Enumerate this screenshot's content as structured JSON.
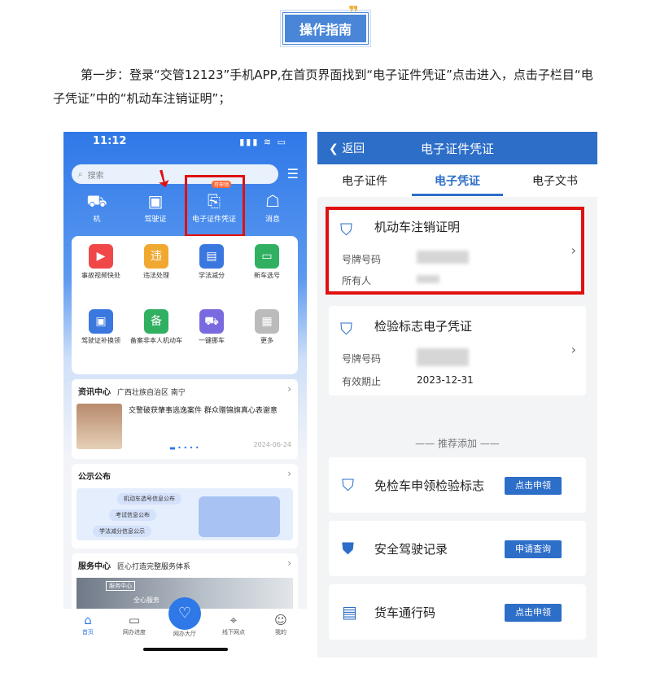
{
  "header": {
    "title": "操作指南",
    "quote_glyph": "❞"
  },
  "instruction": "第一步：登录“交管12123”手机APP,在首页界面找到“电子证件凭证”点击进入，点击子栏目“电子凭证”中的“机动车注销证明”；",
  "left_phone": {
    "time": "11:12",
    "signal": "▮▮▮ ≋ ▭",
    "search_placeholder": "搜索",
    "top_icons": [
      {
        "icon": "car-icon",
        "label": "机"
      },
      {
        "icon": "license-icon",
        "label": "驾驶证"
      },
      {
        "icon": "cert-icon",
        "label": "电子证件凭证"
      },
      {
        "icon": "message-icon",
        "label": "消息"
      }
    ],
    "badge": "可申领",
    "services": [
      {
        "label": "事故视频快处",
        "color": "#f04848"
      },
      {
        "label": "违法处理",
        "color": "#f0a830"
      },
      {
        "label": "学法减分",
        "color": "#3a78e0"
      },
      {
        "label": "新车选号",
        "color": "#30b060"
      },
      {
        "label": "驾驶证补换领",
        "color": "#3a78e0"
      },
      {
        "label": "备案非本人机动车",
        "color": "#30b060"
      },
      {
        "label": "一键挪车",
        "color": "#7a6ae0"
      },
      {
        "label": "更多",
        "color": "#bbbbbb"
      }
    ],
    "news": {
      "title": "资讯中心",
      "region": "广西壮族自治区 南宁",
      "headline": "交警破获肇事逃逸案件 群众赠锦旗真心表谢意",
      "date": "2024-06-24"
    },
    "notice": {
      "title": "公示公布",
      "pills": [
        "机动车选号信息公布",
        "考试信息公布",
        "学法减分信息公示"
      ]
    },
    "service_center": {
      "title": "服务中心",
      "subtitle": "匠心打造完整服务体系",
      "tag": "服务中心",
      "sub": "全心服务"
    },
    "tabbar": [
      "首页",
      "网办进度",
      "网办大厅",
      "线下网点",
      "我的"
    ]
  },
  "right_phone": {
    "back": "返回",
    "title": "电子证件凭证",
    "tabs": [
      "电子证件",
      "电子凭证",
      "电子文书"
    ],
    "cards": [
      {
        "name": "机动车注销证明",
        "label1": "号牌号码",
        "label2": "所有人",
        "value2": ""
      },
      {
        "name": "检验标志电子凭证",
        "label1": "号牌号码",
        "label2": "有效期止",
        "value2": "2023-12-31"
      }
    ],
    "recommend": "——  推荐添加  ——",
    "recommended": [
      {
        "name": "免检车申领检验标志",
        "button": "点击申领"
      },
      {
        "name": "安全驾驶记录",
        "button": "申请查询"
      },
      {
        "name": "货车通行码",
        "button": "点击申领"
      }
    ]
  }
}
